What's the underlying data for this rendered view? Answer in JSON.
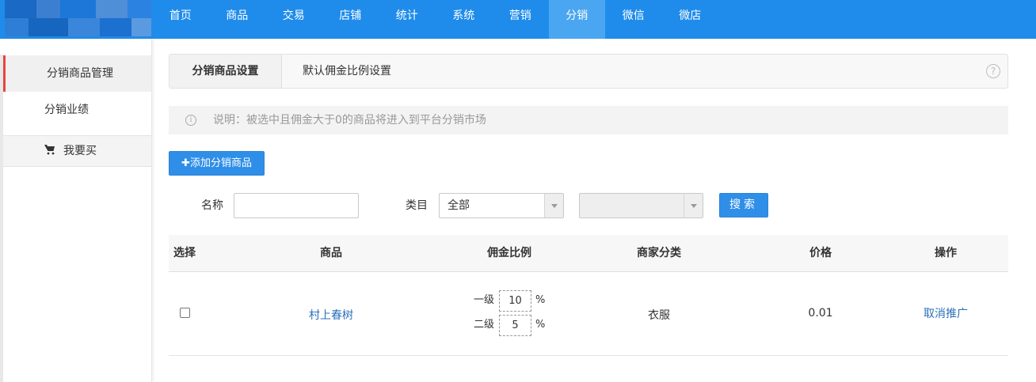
{
  "nav": {
    "items": [
      "首页",
      "商品",
      "交易",
      "店铺",
      "统计",
      "系统",
      "营销",
      "分销",
      "微信",
      "微店"
    ],
    "active_index": 7,
    "color": "#1f8ceb"
  },
  "sidebar": {
    "items": [
      {
        "label": "分销商品管理",
        "active": true
      },
      {
        "label": "分销业绩",
        "active": false
      },
      {
        "label": "我要买",
        "icon": "cart-icon"
      }
    ],
    "active_color": "#e8443e"
  },
  "tabs": {
    "items": [
      "分销商品设置",
      "默认佣金比例设置"
    ],
    "help_icon": "?"
  },
  "notice": {
    "icon": "i",
    "text": "说明：被选中且佣金大于0的商品将进入到平台分销市场"
  },
  "toolbar": {
    "add_label": "✚添加分销商品"
  },
  "filters": {
    "name_label": "名称",
    "name_value": "",
    "category_label": "类目",
    "category_value": "全部",
    "subcategory_value": "",
    "search_label": "搜索"
  },
  "table": {
    "headers": [
      "选择",
      "商品",
      "佣金比例",
      "商家分类",
      "价格",
      "操作"
    ],
    "rows": [
      {
        "checked": false,
        "product": "村上春树",
        "level1_label": "一级",
        "level1_value": "10",
        "level2_label": "二级",
        "level2_value": "5",
        "percent": "%",
        "category": "衣服",
        "price": "0.01",
        "action": "取消推广"
      }
    ]
  }
}
